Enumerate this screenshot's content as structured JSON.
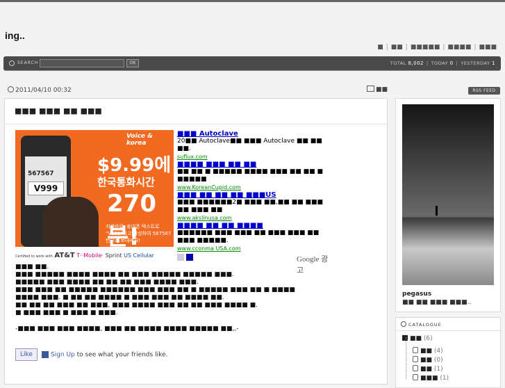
{
  "blog": {
    "title": "ing.."
  },
  "topnav": {
    "items": [
      "■",
      "■■",
      "■■■■■",
      "■■■■",
      "■■■"
    ],
    "separator": "|"
  },
  "searchbar": {
    "label": "SEARCH",
    "placeholder": "",
    "ok_label": "OK",
    "total_label": "TOTAL",
    "total_value": "8,002",
    "today_label": "TODAY",
    "today_value": "0",
    "yesterday_label": "YESTERDAY",
    "yesterday_value": "1",
    "separator": "|"
  },
  "post": {
    "datetime": "2011/04/10 00:32",
    "category": "■■",
    "title": "■■■ ■■■ ■■ ■■■",
    "body": "■■■ ■■.\n■■■ ■■■■■ ■■■■ ■■■■ ■■ ■■■ ■■■■■ ■■■■■ ■■■.\n■■■■■ ■■■ ■■■■ ■■ ■■ ■■ ■■■ ■■■■ ■■■.\n■■■ ■■■ ■■ ■■■■■ ■■■■■■ ■■■ ■■■ ■■ ■ ■■■■■ ■■■ ■■ ■ ■■■■\n■■■■ ■■■. ■ ■■ ■■ ■■■■ ■ ■■■ ■■■ ■■ ■■■■ ■■.\n■■ ■■ ■■ ■■■ ■■ ■■■, ■■■ ■■■■ ■■■ ■■ ■■ ■■■ ■■■■ ■.\n■ ■■■ ■■■ ■ ■■■ ■ ■■■.",
    "ending": "-■■■ ■■■ ■■■ ■■■■, ■■■ ■■ ■■■■ ■■■■ ■■■■■ ■■,,-"
  },
  "ad_image": {
    "brand": "Voice & korea",
    "number_small": "567567",
    "code": "V999",
    "price": "$9.99에",
    "line2": "한국통화시간",
    "minutes": "270분!",
    "small_text": "지금바로, 휴대폰 텍스트로 \"V999\"라고 작성하여 567567번으로 보내세요!",
    "carriers_prefix": "Certified to work with",
    "carrier1": "AT&T",
    "carrier2": "T··Mobile·",
    "carrier3": "Sprint",
    "carrier4": "US Cellular"
  },
  "ad_links": [
    {
      "title": "■■■ Autoclave",
      "desc": "20■■ Autoclave■■ ■■■ Autoclave ■■ ■■ ■■.",
      "url": "suflux.com"
    },
    {
      "title": "■■■■ ■■■ ■■ ■■",
      "desc": "■■ ■■ ■ ■■■■■ ■■■■ ■■■ ■■ ■■ ■ ■■■■■",
      "url": "www.KoreanCupid.com"
    },
    {
      "title": "■■■ ■■ ■■ ■■ ■■■US",
      "desc": "■■■ ■■■■■■2■ ■■■ ■■,■■ ■■ ■■■ ■■ ■■■ ■■",
      "url": "www.akslinusa.com"
    },
    {
      "title": "■■■■ ■■ ■■ ■■■■",
      "desc": "■■■■■■ ■■■ ■■■ ■■ ■■■ ■■■ ■■ ■■■ ■■■■■.",
      "url": "www.cconma USA.com"
    }
  ],
  "ad_footer": {
    "google": "Google 광고"
  },
  "facebook": {
    "like": "Like",
    "signup": "Sign Up",
    "rest": " to see what your friends like."
  },
  "sidebar": {
    "rss": "RSS FEED",
    "owner_name": "pegasus",
    "owner_desc": "■■ ■■ ■■■ ■■■.."
  },
  "catalogue": {
    "heading": "CATALOGUE",
    "root": {
      "label": "■■",
      "count": "(6)"
    },
    "children": [
      {
        "label": "■■",
        "count": "(4)"
      },
      {
        "label": "■■",
        "count": "(0)"
      },
      {
        "label": "■■",
        "count": "(1)"
      },
      {
        "label": "■■■",
        "count": "(1)"
      }
    ]
  },
  "colors": {
    "bar": "#4a4a4a",
    "link": "#0000cc",
    "url": "#008000",
    "ad_orange": "#f26a21"
  }
}
